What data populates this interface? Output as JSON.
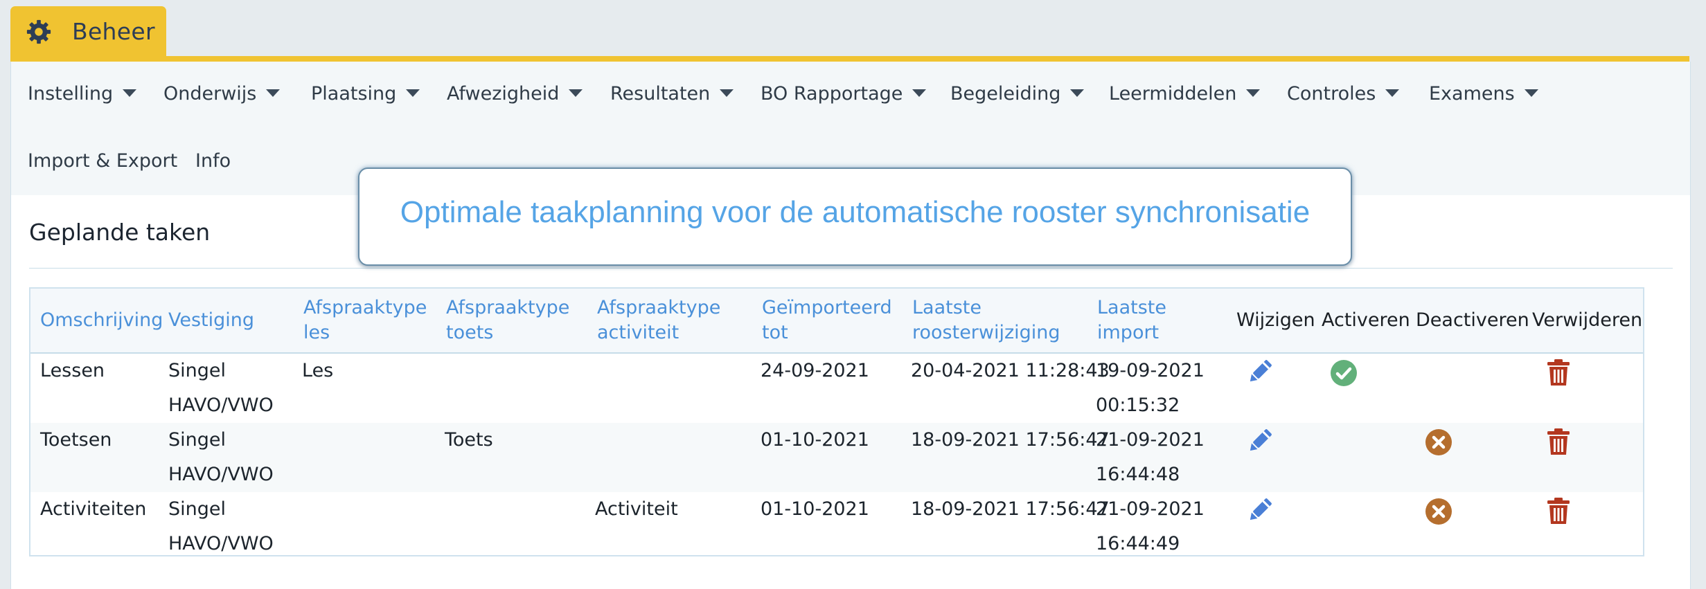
{
  "tab": {
    "label": "Beheer",
    "icon": "gear-icon"
  },
  "menu": {
    "items": [
      {
        "label": "Instelling",
        "has_dropdown": true
      },
      {
        "label": "Onderwijs",
        "has_dropdown": true
      },
      {
        "label": "Plaatsing",
        "has_dropdown": true
      },
      {
        "label": "Afwezigheid",
        "has_dropdown": true
      },
      {
        "label": "Resultaten",
        "has_dropdown": true
      },
      {
        "label": "BO Rapportage",
        "has_dropdown": true
      },
      {
        "label": "Begeleiding",
        "has_dropdown": true
      },
      {
        "label": "Leermiddelen",
        "has_dropdown": true
      },
      {
        "label": "Controles",
        "has_dropdown": true
      },
      {
        "label": "Examens",
        "has_dropdown": true
      },
      {
        "label": "Import & Export",
        "has_dropdown": false
      },
      {
        "label": "Info",
        "has_dropdown": false
      }
    ]
  },
  "callout": {
    "text": "Optimale taakplanning voor de automatische rooster synchronisatie"
  },
  "page": {
    "title": "Geplande taken"
  },
  "table": {
    "headers": {
      "omschrijving": "Omschrijving",
      "vestiging": "Vestiging",
      "afspraaktype_les": [
        "Afspraaktype",
        "les"
      ],
      "afspraaktype_toets": [
        "Afspraaktype",
        "toets"
      ],
      "afspraaktype_activiteit": [
        "Afspraaktype",
        "activiteit"
      ],
      "geimporteerd_tot": [
        "Geïmporteerd",
        "tot"
      ],
      "laatste_roosterwijziging": [
        "Laatste",
        "roosterwijziging"
      ],
      "laatste_import": [
        "Laatste",
        "import"
      ],
      "wijzigen": "Wijzigen",
      "activeren": "Activeren",
      "deactiveren": "Deactiveren",
      "verwijderen": "Verwijderen"
    },
    "rows": [
      {
        "omschrijving": "Lessen",
        "vestiging": [
          "Singel",
          "HAVO/VWO"
        ],
        "afspraaktype_les": "Les",
        "afspraaktype_toets": "",
        "afspraaktype_activiteit": "",
        "geimporteerd_tot": "24-09-2021",
        "laatste_roosterwijziging": "20-04-2021 11:28:43",
        "laatste_import": [
          "19-09-2021",
          "00:15:32"
        ],
        "status": "inactive"
      },
      {
        "omschrijving": "Toetsen",
        "vestiging": [
          "Singel",
          "HAVO/VWO"
        ],
        "afspraaktype_les": "",
        "afspraaktype_toets": "Toets",
        "afspraaktype_activiteit": "",
        "geimporteerd_tot": "01-10-2021",
        "laatste_roosterwijziging": "18-09-2021 17:56:47",
        "laatste_import": [
          "21-09-2021",
          "16:44:48"
        ],
        "status": "active"
      },
      {
        "omschrijving": "Activiteiten",
        "vestiging": [
          "Singel",
          "HAVO/VWO"
        ],
        "afspraaktype_les": "",
        "afspraaktype_toets": "",
        "afspraaktype_activiteit": "Activiteit",
        "geimporteerd_tot": "01-10-2021",
        "laatste_roosterwijziging": "18-09-2021 17:56:47",
        "laatste_import": [
          "21-09-2021",
          "16:44:49"
        ],
        "status": "active"
      }
    ]
  },
  "colors": {
    "tab_accent": "#f0c331",
    "header_text": "#4a90d9",
    "edit_icon": "#4a7fd6",
    "activate_icon": "#62b07a",
    "deactivate_icon": "#b56e2e",
    "delete_icon": "#b3371f",
    "callout_text": "#55a4e6"
  }
}
